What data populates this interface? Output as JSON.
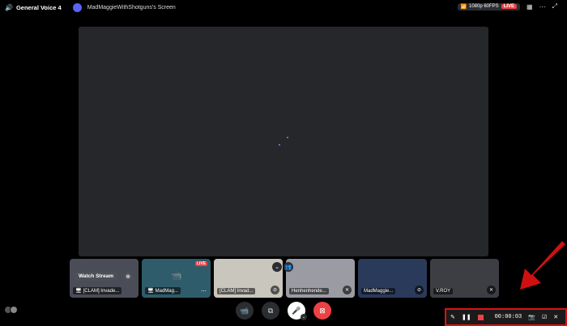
{
  "header": {
    "channel": "General Voice 4",
    "screen_title": "MadMaggieWithShotguns's Screen",
    "quality": "1080p 60FPS",
    "live": "LIVE"
  },
  "tiles": [
    {
      "label": "[CLAM] Invade...",
      "watch": "Watch Stream"
    },
    {
      "label": "MadMag...",
      "live": "LIVE"
    },
    {
      "label": "[CLAM] Invad..."
    },
    {
      "label": "Henhenhende..."
    },
    {
      "label": "MadMaggie..."
    },
    {
      "label": "V.ROY"
    }
  ],
  "recorder": {
    "time": "00:00:03"
  },
  "colors": {
    "accent": "#5865f2",
    "danger": "#ed4245",
    "stage": "#25272b"
  }
}
